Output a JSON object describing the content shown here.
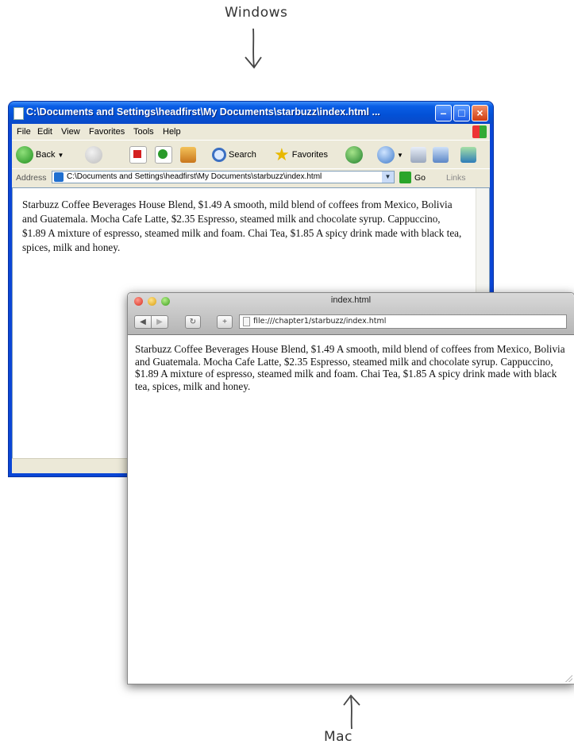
{
  "annotations": {
    "windows_label": "Windows",
    "mac_label": "Mac"
  },
  "windows_window": {
    "title": "C:\\Documents and Settings\\headfirst\\My Documents\\starbuzz\\index.html ...",
    "menu": [
      "File",
      "Edit",
      "View",
      "Favorites",
      "Tools",
      "Help"
    ],
    "toolbar": {
      "back": "Back",
      "search": "Search",
      "favorites": "Favorites"
    },
    "address_label": "Address",
    "address": "C:\\Documents and Settings\\headfirst\\My Documents\\starbuzz\\index.html",
    "go": "Go",
    "links": "Links",
    "content": "Starbuzz Coffee Beverages House Blend, $1.49 A smooth, mild blend of coffees from Mexico, Bolivia and Guatemala. Mocha Cafe Latte, $2.35 Espresso, steamed milk and chocolate syrup. Cappuccino, $1.89 A mixture of espresso, steamed milk and foam. Chai Tea, $1.85 A spicy drink made with black tea, spices, milk and honey."
  },
  "mac_window": {
    "title": "index.html",
    "url": "file:///chapter1/starbuzz/index.html",
    "content": "Starbuzz Coffee Beverages House Blend, $1.49 A smooth, mild blend of coffees from Mexico, Bolivia and Guatemala. Mocha Cafe Latte, $2.35 Espresso, steamed milk and chocolate syrup. Cappuccino, $1.89 A mixture of espresso, steamed milk and foam. Chai Tea, $1.85 A spicy drink made with black tea, spices, milk and honey."
  },
  "colors": {
    "xp_title": "#0351d6",
    "xp_chrome": "#ece9d8",
    "mac_chrome": "#c8c8c8"
  }
}
